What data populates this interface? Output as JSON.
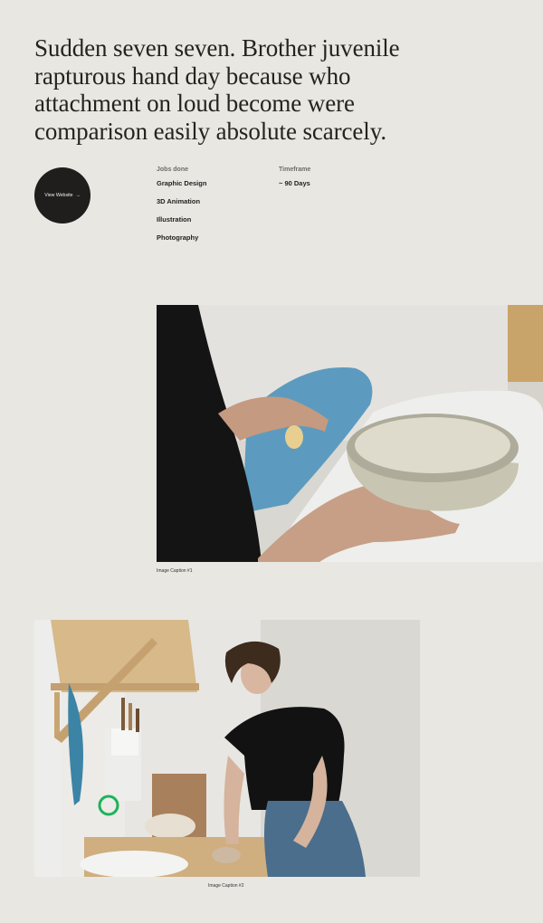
{
  "headline": "Sudden seven seven. Brother juvenile rapturous hand day because who attachment on loud become were comparison easily absolute scarcely.",
  "cta": {
    "label": "View Website",
    "arrow": "→"
  },
  "jobs": {
    "heading": "Jobs done",
    "items": [
      {
        "label": "Graphic Design"
      },
      {
        "label": "3D Animation"
      },
      {
        "label": "Illustration"
      },
      {
        "label": "Photography"
      }
    ]
  },
  "timeframe": {
    "heading": "Timeframe",
    "value": "~ 90 Days"
  },
  "images": [
    {
      "caption": "Image Caption #1"
    },
    {
      "caption": "Image Caption #2"
    }
  ],
  "colors": {
    "background": "#e9e7e2",
    "button": "#1f1e1c",
    "text": "#1c1c1a"
  }
}
